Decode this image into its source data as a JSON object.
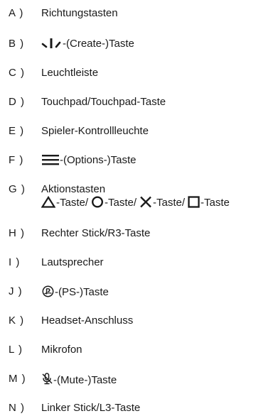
{
  "items": [
    {
      "letter": "A )",
      "label": "Richtungstasten"
    },
    {
      "letter": "B )",
      "label": "-(Create-)Taste",
      "icon": "create-icon"
    },
    {
      "letter": "C )",
      "label": "Leuchtleiste"
    },
    {
      "letter": "D )",
      "label": "Touchpad/Touchpad-Taste"
    },
    {
      "letter": "E )",
      "label": "Spieler-Kontrollleuchte"
    },
    {
      "letter": "F )",
      "label": "-(Options-)Taste",
      "icon": "options-icon"
    },
    {
      "letter": "G )",
      "label": "Aktionstasten",
      "sub": [
        {
          "icon": "triangle-icon",
          "label": "-Taste/"
        },
        {
          "icon": "circle-icon",
          "label": "-Taste/"
        },
        {
          "icon": "cross-icon",
          "label": "-Taste/"
        },
        {
          "icon": "square-icon",
          "label": "-Taste"
        }
      ]
    },
    {
      "letter": "H )",
      "label": "Rechter Stick/R3-Taste"
    },
    {
      "letter": "I )",
      "label": "Lautsprecher"
    },
    {
      "letter": "J )",
      "label": "-(PS-)Taste",
      "icon": "ps-icon"
    },
    {
      "letter": "K )",
      "label": "Headset-Anschluss"
    },
    {
      "letter": "L )",
      "label": "Mikrofon"
    },
    {
      "letter": "M )",
      "label": "-(Mute-)Taste",
      "icon": "mute-icon"
    },
    {
      "letter": "N )",
      "label": "Linker Stick/L3-Taste"
    }
  ]
}
